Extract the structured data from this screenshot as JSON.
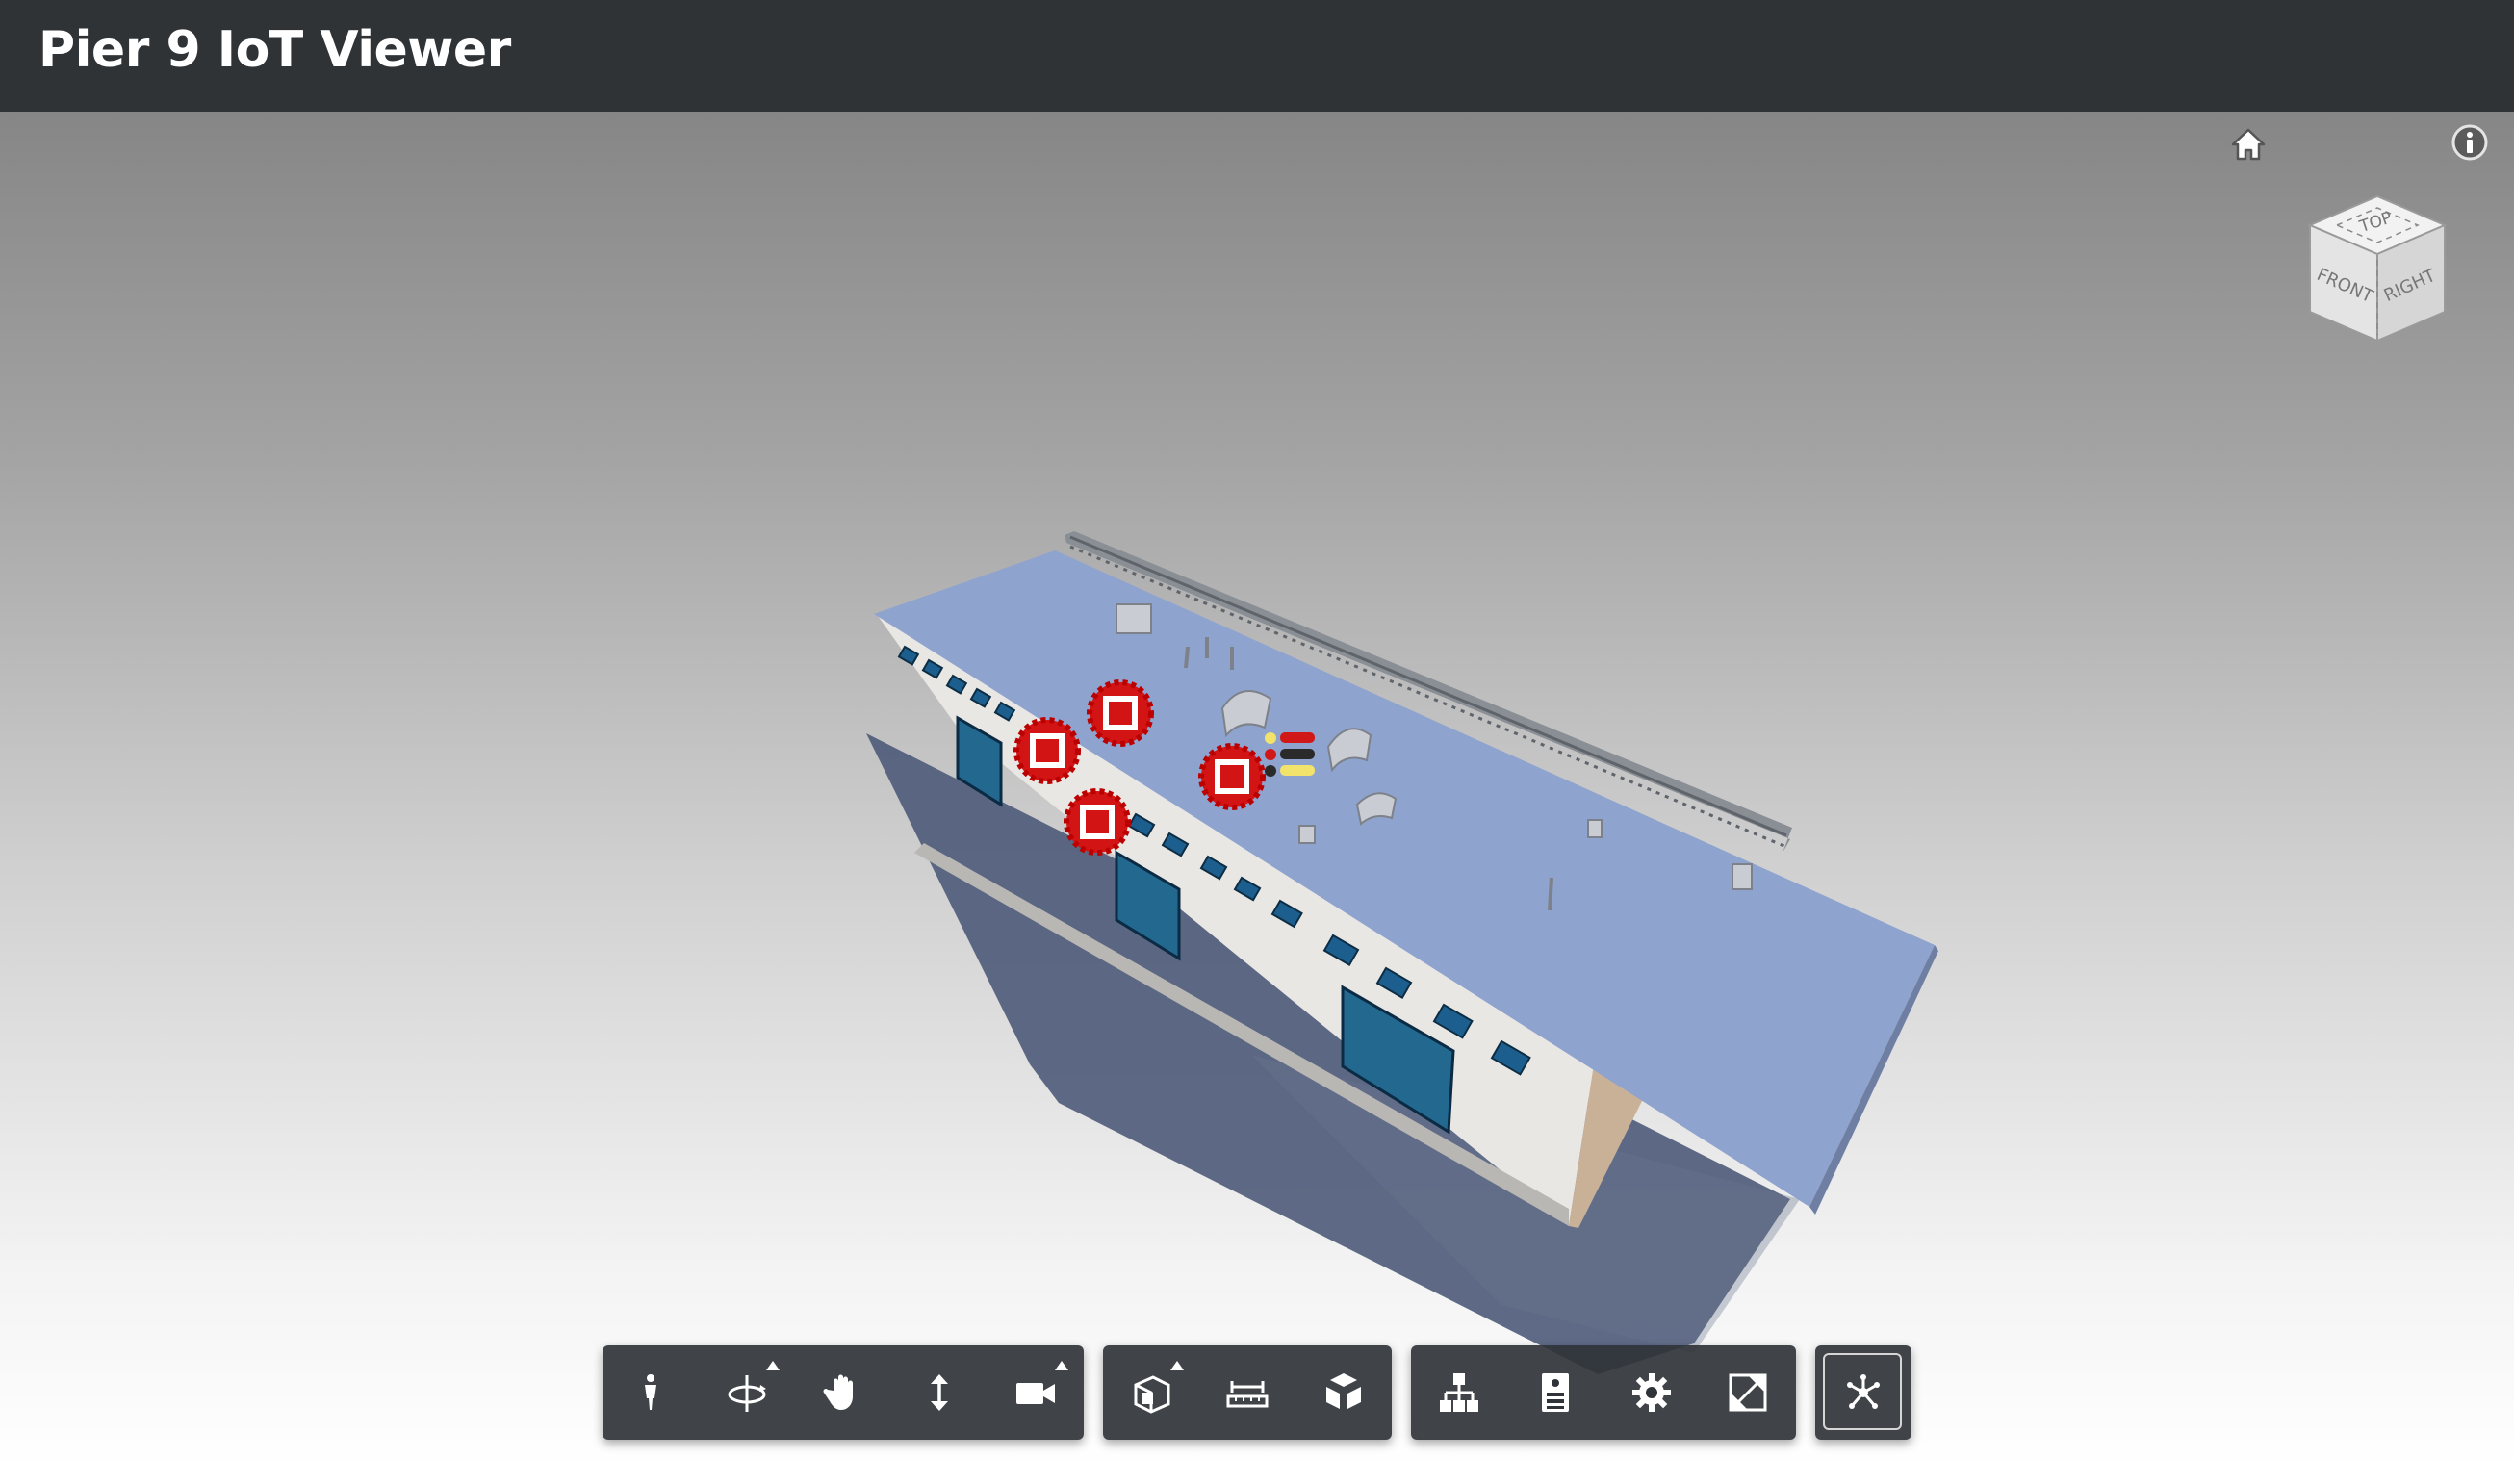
{
  "header": {
    "title": "Pier 9 IoT Viewer"
  },
  "viewport": {
    "corner_controls": {
      "home_icon": "home-icon",
      "info_icon": "info-icon"
    },
    "viewcube": {
      "top_label": "TOP",
      "front_label": "FRONT",
      "right_label": "RIGHT"
    },
    "sensor_markers": 4,
    "sensor_color": "#cc1010",
    "roof_color": "#8fa3cf",
    "wall_color": "#e8e6e3",
    "shadow_color": "#4b5a78"
  },
  "toolbar": {
    "groups": [
      {
        "name": "navigation",
        "tools": [
          "first-person-icon",
          "orbit-icon",
          "pan-icon",
          "dolly-icon",
          "camera-icon"
        ]
      },
      {
        "name": "model",
        "tools": [
          "section-icon",
          "measure-icon",
          "explode-icon"
        ]
      },
      {
        "name": "settings",
        "tools": [
          "model-browser-icon",
          "properties-icon",
          "settings-icon",
          "fullscreen-icon"
        ]
      },
      {
        "name": "extensions",
        "tools": [
          "iot-sensors-icon"
        ]
      }
    ]
  }
}
